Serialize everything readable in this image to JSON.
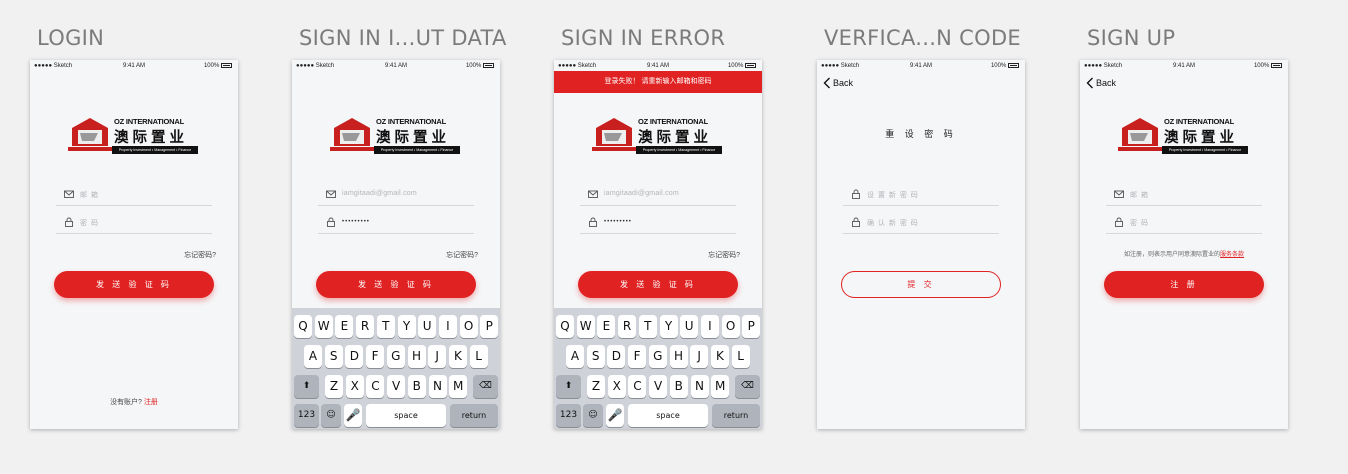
{
  "boards": [
    {
      "title": "LOGIN"
    },
    {
      "title": "SIGN IN I...UT DATA"
    },
    {
      "title": "SIGN IN ERROR"
    },
    {
      "title": "VERFICA...N CODE"
    },
    {
      "title": "SIGN UP"
    }
  ],
  "status": {
    "carrier": "●●●●● Sketch",
    "wifi": "≈",
    "time": "9:41 AM",
    "battery": "100%"
  },
  "logo": {
    "en": "OZ INTERNATIONAL",
    "cn": "澳际置业",
    "sub": "Property Investment • Management • Finance"
  },
  "login": {
    "email_placeholder": "邮 箱",
    "password_placeholder": "密 码",
    "forgot": "忘记密码?",
    "send_button": "发 送 验 证 码",
    "no_account": "没有账户?",
    "signup_link": "注册"
  },
  "input_data": {
    "email_value": "iamgitaadi@gmail.com",
    "password_value": "•••••••••",
    "forgot": "忘记密码?",
    "send_button": "发 送 验 证 码"
  },
  "error": {
    "banner": "登录失败！ 请重新输入邮箱和密码",
    "email_value": "iamgitaadi@gmail.com",
    "password_value": "•••••••••",
    "forgot": "忘记密码?",
    "send_button": "发 送 验 证 码"
  },
  "verify": {
    "back": "Back",
    "title": "重 设 密 码",
    "new_password": "设 置 新 密 码",
    "confirm_password": "确 认 新 密 码",
    "submit": "提 交"
  },
  "signup": {
    "back": "Back",
    "email_placeholder": "邮 箱",
    "password_placeholder": "密 码",
    "terms_text": "如注册，则表示用户同意澳际置业的",
    "terms_link": "服务条款",
    "register_button": "注 册"
  },
  "keyboard": {
    "row1": [
      "Q",
      "W",
      "E",
      "R",
      "T",
      "Y",
      "U",
      "I",
      "O",
      "P"
    ],
    "row2": [
      "A",
      "S",
      "D",
      "F",
      "G",
      "H",
      "J",
      "K",
      "L"
    ],
    "row3": [
      "Z",
      "X",
      "C",
      "V",
      "B",
      "N",
      "M"
    ],
    "shift": "⬆",
    "delete": "⌫",
    "numbers": "123",
    "emoji": "☺",
    "mic": "🎤",
    "space": "space",
    "return": "return"
  },
  "colors": {
    "accent": "#e02222",
    "background": "#f1f1f2",
    "screen": "#f5f6f8"
  }
}
